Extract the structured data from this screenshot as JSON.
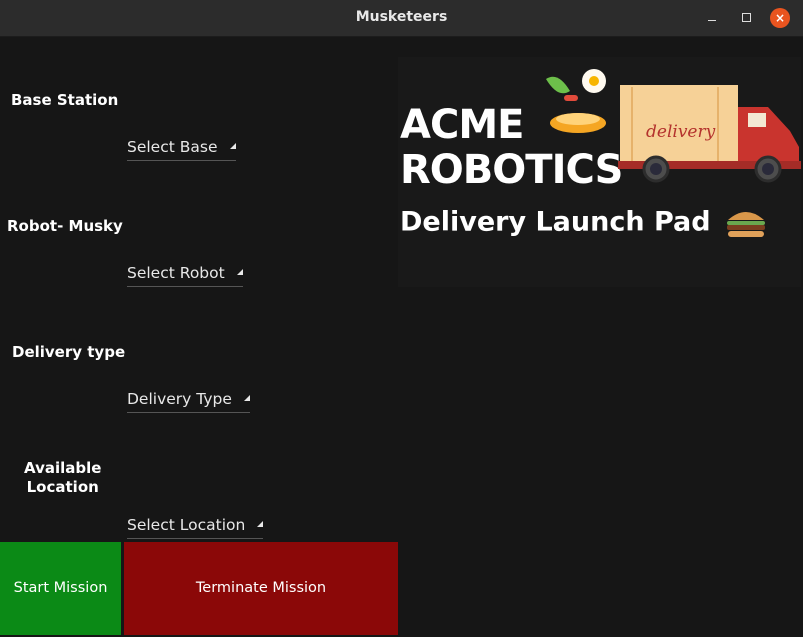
{
  "window": {
    "title": "Musketeers"
  },
  "form": {
    "base_station": {
      "label": "Base Station",
      "select_value": "Select Base"
    },
    "robot": {
      "label": "Robot- Musky",
      "select_value": "Select Robot"
    },
    "delivery_type": {
      "label": "Delivery type",
      "select_value": "Delivery Type"
    },
    "location": {
      "label_line1": "Available",
      "label_line2": "Location",
      "select_value": "Select Location"
    }
  },
  "buttons": {
    "start": "Start Mission",
    "terminate": "Terminate Mission"
  },
  "banner": {
    "brand_line1": "ACME",
    "brand_line2": "ROBOTICS",
    "truck_text": "delivery",
    "tagline": "Delivery Launch Pad"
  },
  "colors": {
    "start": "#0b8a16",
    "terminate": "#8b0808",
    "close": "#e9541f"
  }
}
